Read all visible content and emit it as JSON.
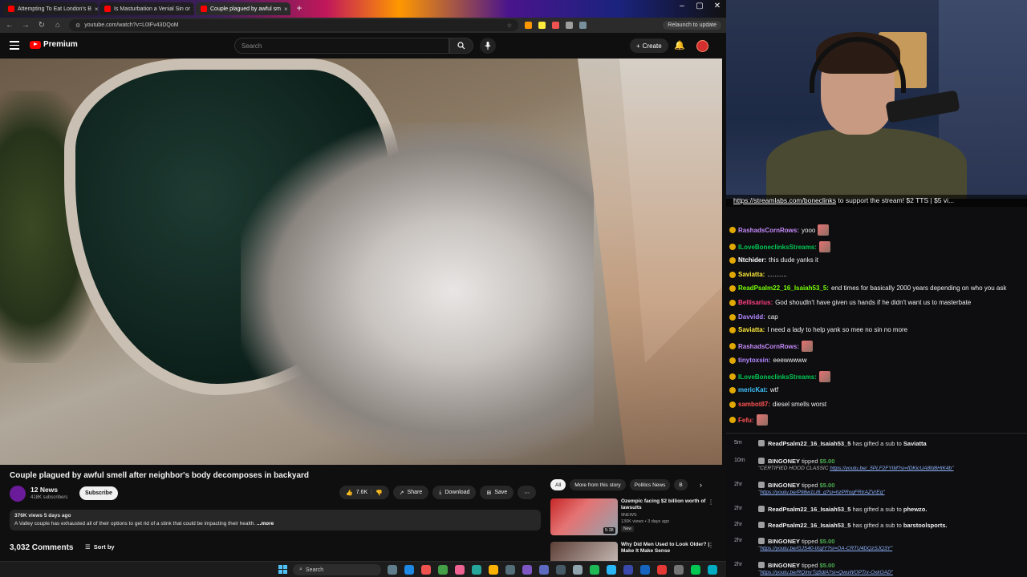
{
  "browser": {
    "tabs": [
      {
        "label": "Attempting To Eat London's B"
      },
      {
        "label": "Is Masturbation a Venial Sin or"
      },
      {
        "label": "Couple plagued by awful sm"
      }
    ],
    "url": "youtube.com/watch?v=L0IFv43DQoM",
    "relaunch": "Relaunch to update"
  },
  "youtube": {
    "logo": "Premium",
    "search_placeholder": "Search",
    "create_label": "Create",
    "video_title": "Couple plagued by awful smell after neighbor's body decomposes in backyard",
    "channel_name": "12 News",
    "subscribers": "418K subscribers",
    "subscribe_label": "Subscribe",
    "likes": "7.6K",
    "share_label": "Share",
    "download_label": "Download",
    "save_label": "Save",
    "desc_meta": "376K views  5 days ago",
    "desc_text": "A Valley couple has exhausted all of their options to get rid of a stink that could be impacting their health.",
    "desc_more": "...more",
    "comments_count": "3,032 Comments",
    "sort_label": "Sort by",
    "chips": [
      "All",
      "More from this story",
      "Politics News",
      "B"
    ],
    "recs": [
      {
        "title": "Ozempic facing $2 billion worth of lawsuits",
        "channel": "9NEWS",
        "views": "130K views • 3 days ago",
        "badge": "New",
        "duration": "5:38"
      },
      {
        "title": "Why Did Men Used to Look Older? | Make It Make Sense",
        "channel": "",
        "views": "",
        "badge": "",
        "duration": ""
      }
    ]
  },
  "taskbar": {
    "search_label": "Search"
  },
  "stream": {
    "banner_link": "https://streamlabs.com/boneclinks",
    "banner_text": " to support the stream! $2 TTS | $5 vi..."
  },
  "chat": [
    {
      "user": "RashadsCornRows:",
      "text": "yooo",
      "color": "#c58af9",
      "emote": true
    },
    {
      "user": "ILoveBoneclinksStreams:",
      "text": "",
      "color": "#00c853",
      "emote": true
    },
    {
      "user": "Ntchider:",
      "text": "this dude yanks it",
      "color": "#ffffff",
      "emote": false
    },
    {
      "user": "Saviatta:",
      "text": "...........",
      "color": "#ffeb3b",
      "emote": false
    },
    {
      "user": "ReadPsalm22_16_Isaiah53_5:",
      "text": "end times for basically 2000 years depending on who you ask",
      "color": "#76ff03",
      "emote": false
    },
    {
      "user": "Bellisarius:",
      "text": "God shoudln't have given us hands if he didn't want us to masterbate",
      "color": "#ff4081",
      "emote": false
    },
    {
      "user": "Davvidd:",
      "text": "cap",
      "color": "#b388ff",
      "emote": false
    },
    {
      "user": "Saviatta:",
      "text": "I need a lady to help yank so mee no sin no more",
      "color": "#ffeb3b",
      "emote": false
    },
    {
      "user": "RashadsCornRows:",
      "text": "",
      "color": "#c58af9",
      "emote": true
    },
    {
      "user": "tinytoxsin:",
      "text": "eeewwwww",
      "color": "#b388ff",
      "emote": false
    },
    {
      "user": "ILoveBoneclinksStreams:",
      "text": "",
      "color": "#00c853",
      "emote": true
    },
    {
      "user": "mericKat:",
      "text": "wtf",
      "color": "#40c4ff",
      "emote": false
    },
    {
      "user": "sambot87:",
      "text": "diesel smells worst",
      "color": "#ff5252",
      "emote": false
    },
    {
      "user": "Fefu:",
      "text": "",
      "color": "#ff5252",
      "emote": true
    }
  ],
  "events": [
    {
      "time": "5m",
      "pre": "",
      "user": "ReadPsalm22_16_Isaiah53_5",
      "mid": " has gifted a sub to ",
      "target": "Saviatta",
      "amount": "",
      "note": "",
      "link": ""
    },
    {
      "time": "10m",
      "pre": "",
      "user": "BINGONEY",
      "mid": " tipped ",
      "target": "",
      "amount": "$5.00",
      "note": "\"CERTIFIED HOOD CLASSIC ",
      "link": "https://youtu.be/_5PLF2FYIM?si=fDKicUA8fd8HtK4b\""
    },
    {
      "time": "2hr",
      "pre": "",
      "user": "BINGONEY",
      "mid": " tipped ",
      "target": "",
      "amount": "$5.00",
      "note": "\"",
      "link": "https://youtu.be/P98w1Lt6_g?si=hzPRogFRtrAZVrEq\""
    },
    {
      "time": "2hr",
      "pre": "",
      "user": "ReadPsalm22_16_Isaiah53_5",
      "mid": " has gifted a sub to ",
      "target": "phewzo.",
      "amount": "",
      "note": "",
      "link": ""
    },
    {
      "time": "2hr",
      "pre": "",
      "user": "ReadPsalm22_16_Isaiah53_5",
      "mid": " has gifted a sub to ",
      "target": "barstoolsports.",
      "amount": "",
      "note": "",
      "link": ""
    },
    {
      "time": "2hr",
      "pre": "",
      "user": "BINGONEY",
      "mid": " tipped ",
      "target": "",
      "amount": "$5.00",
      "note": "\"",
      "link": "https://youtu.be/GJS40-lXgIY?si=OA-CRTU4DQzSJQ3Y\""
    },
    {
      "time": "2hr",
      "pre": "",
      "user": "BINGONEY",
      "mid": " tipped ",
      "target": "",
      "amount": "$5.00",
      "note": "\"",
      "link": "https://youtu.be/RQimrTg5dlA?si=QwuWOPTrx-OxkOAD\""
    }
  ]
}
